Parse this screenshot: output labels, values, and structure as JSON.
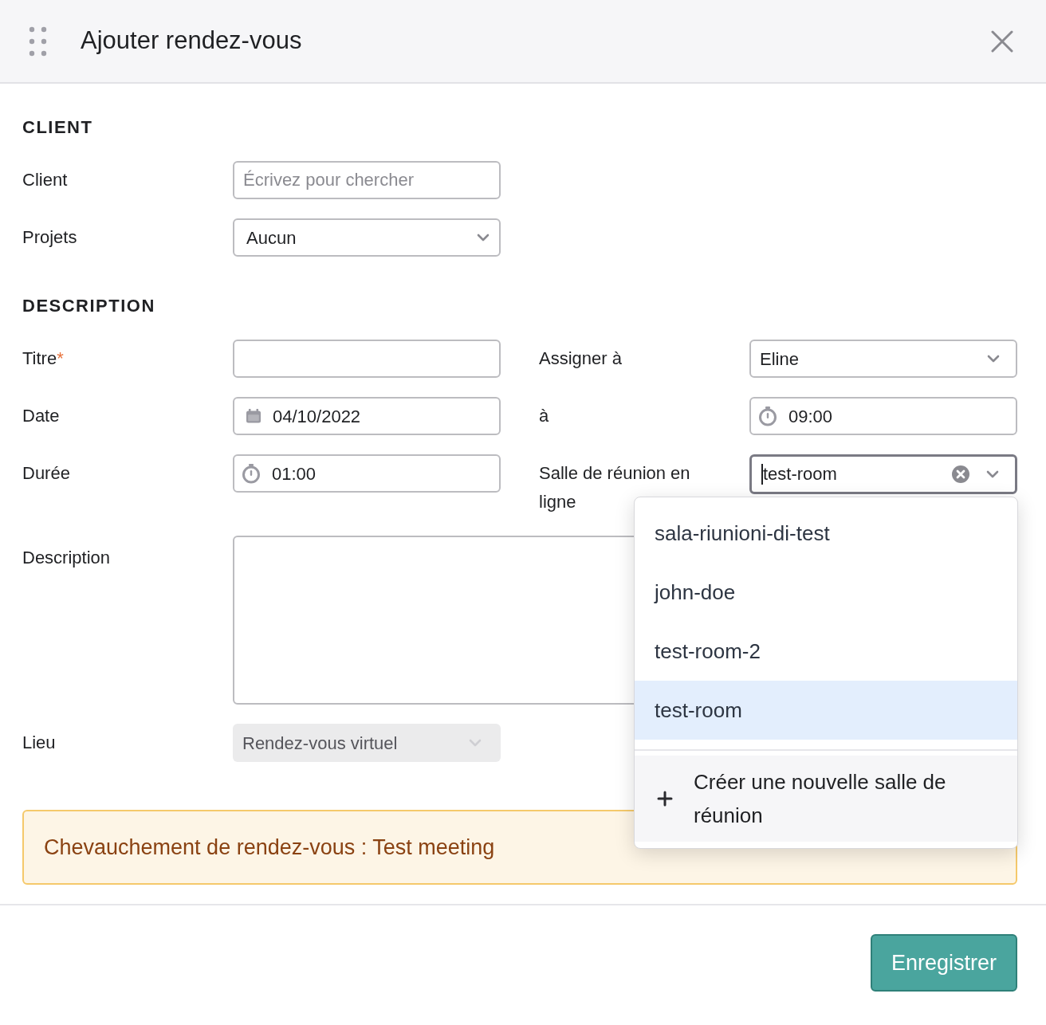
{
  "dialog": {
    "title": "Ajouter rendez-vous"
  },
  "client_section": {
    "heading": "CLIENT",
    "client": {
      "label": "Client",
      "placeholder": "Écrivez pour chercher"
    },
    "projects": {
      "label": "Projets",
      "value": "Aucun"
    }
  },
  "description_section": {
    "heading": "DESCRIPTION",
    "title": {
      "label": "Titre",
      "required": true,
      "required_mark": "*"
    },
    "assign": {
      "label": "Assigner à",
      "value": "Eline"
    },
    "date": {
      "label": "Date",
      "value": "04/10/2022"
    },
    "time": {
      "label": "à",
      "value": "09:00"
    },
    "duration": {
      "label": "Durée",
      "value": "01:00"
    },
    "room": {
      "label": "Salle de réunion en ligne",
      "value": "test-room",
      "focused": true,
      "expanded": true,
      "options": [
        {
          "label": "sala-riunioni-di-test",
          "selected": false
        },
        {
          "label": "john-doe",
          "selected": false
        },
        {
          "label": "test-room-2",
          "selected": false
        },
        {
          "label": "test-room",
          "selected": true
        }
      ],
      "create_action": "Créer une nouvelle salle de réunion"
    },
    "description": {
      "label": "Description"
    },
    "location": {
      "label": "Lieu",
      "value": "Rendez-vous virtuel",
      "disabled": true
    }
  },
  "alert": {
    "text": "Chevauchement de rendez-vous : Test meeting"
  },
  "footer": {
    "save_button": "Enregistrer"
  }
}
